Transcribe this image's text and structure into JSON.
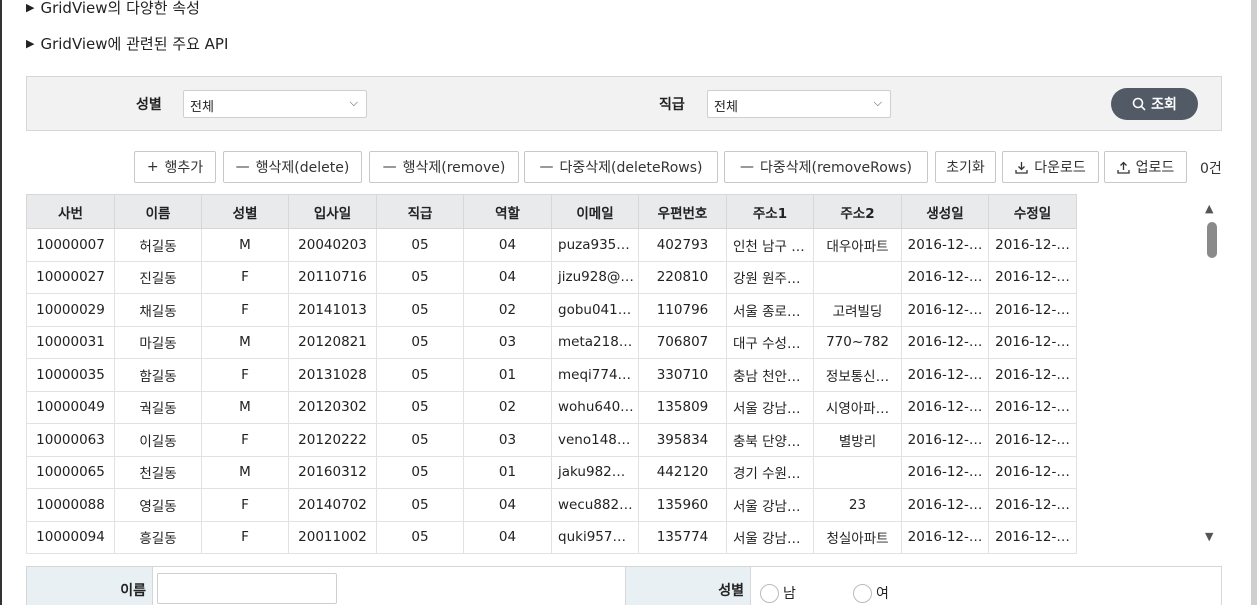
{
  "sections": {
    "props_title": "GridView의 다양한 속성",
    "api_title": "GridView에 관련된 주요 API"
  },
  "search": {
    "gender_label": "성별",
    "gender_value": "전체",
    "rank_label": "직급",
    "rank_value": "전체",
    "search_button": "조회"
  },
  "toolbar": {
    "add_row": "행추가",
    "delete_row": "행삭제(delete)",
    "remove_row": "행삭제(remove)",
    "delete_rows": "다중삭제(deleteRows)",
    "remove_rows": "다중삭제(removeRows)",
    "reset": "초기화",
    "download": "다운로드",
    "upload": "업로드",
    "count": "0건"
  },
  "grid": {
    "columns": [
      "사번",
      "이름",
      "성별",
      "입사일",
      "직급",
      "역할",
      "이메일",
      "우편번호",
      "주소1",
      "주소2",
      "생성일",
      "수정일"
    ],
    "rows": [
      [
        "10000007",
        "허길동",
        "M",
        "20040203",
        "05",
        "04",
        "puza935…",
        "402793",
        "인천 남구 …",
        "대우아파트",
        "2016-12-…",
        "2016-12-…"
      ],
      [
        "10000027",
        "진길동",
        "F",
        "20110716",
        "05",
        "04",
        "jizu928@…",
        "220810",
        "강원 원주…",
        "",
        "2016-12-…",
        "2016-12-…"
      ],
      [
        "10000029",
        "채길동",
        "F",
        "20141013",
        "05",
        "02",
        "gobu041…",
        "110796",
        "서울 종로…",
        "고려빌딩",
        "2016-12-…",
        "2016-12-…"
      ],
      [
        "10000031",
        "마길동",
        "M",
        "20120821",
        "05",
        "03",
        "meta218…",
        "706807",
        "대구 수성…",
        "770~782",
        "2016-12-…",
        "2016-12-…"
      ],
      [
        "10000035",
        "함길동",
        "F",
        "20131028",
        "05",
        "01",
        "meqi774…",
        "330710",
        "충남 천안…",
        "정보통신…",
        "2016-12-…",
        "2016-12-…"
      ],
      [
        "10000049",
        "궉길동",
        "M",
        "20120302",
        "05",
        "02",
        "wohu640…",
        "135809",
        "서울 강남…",
        "시영아파…",
        "2016-12-…",
        "2016-12-…"
      ],
      [
        "10000063",
        "이길동",
        "F",
        "20120222",
        "05",
        "03",
        "veno148…",
        "395834",
        "충북 단양…",
        "별방리",
        "2016-12-…",
        "2016-12-…"
      ],
      [
        "10000065",
        "천길동",
        "M",
        "20160312",
        "05",
        "01",
        "jaku982…",
        "442120",
        "경기 수원…",
        "",
        "2016-12-…",
        "2016-12-…"
      ],
      [
        "10000088",
        "영길동",
        "F",
        "20140702",
        "05",
        "04",
        "wecu882…",
        "135960",
        "서울 강남…",
        "23",
        "2016-12-…",
        "2016-12-…"
      ],
      [
        "10000094",
        "흥길동",
        "F",
        "20011002",
        "05",
        "04",
        "quki957…",
        "135774",
        "서울 강남…",
        "청실아파트",
        "2016-12-…",
        "2016-12-…"
      ]
    ]
  },
  "form": {
    "name_label": "이름",
    "name_value": "",
    "gender_label": "성별",
    "male": "남",
    "female": "여"
  }
}
